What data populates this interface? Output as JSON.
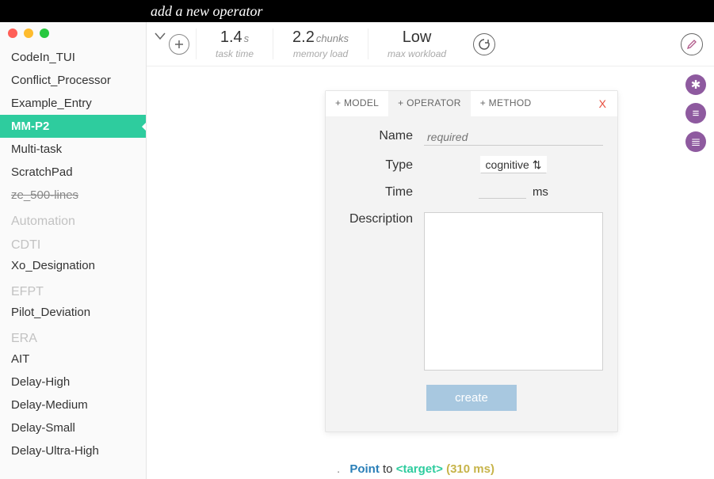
{
  "annotation": "add a new operator",
  "sidebar": {
    "items": [
      {
        "label": "CodeIn_TUI",
        "active": false
      },
      {
        "label": "Conflict_Processor",
        "active": false
      },
      {
        "label": "Example_Entry",
        "active": false
      },
      {
        "label": "MM-P2",
        "active": true
      },
      {
        "label": "Multi-task",
        "active": false
      },
      {
        "label": "ScratchPad",
        "active": false
      },
      {
        "label": "ze_500-lines",
        "strike": true
      }
    ],
    "groups": [
      {
        "heading": "Automation",
        "items": []
      },
      {
        "heading": "CDTI",
        "items": [
          {
            "label": "Xo_Designation"
          }
        ]
      },
      {
        "heading": "EFPT",
        "items": [
          {
            "label": "Pilot_Deviation"
          }
        ]
      },
      {
        "heading": "ERA",
        "items": [
          {
            "label": "AIT"
          },
          {
            "label": "Delay-High"
          },
          {
            "label": "Delay-Medium"
          },
          {
            "label": "Delay-Small"
          },
          {
            "label": "Delay-Ultra-High"
          }
        ]
      }
    ]
  },
  "metrics": {
    "task_time": {
      "value": "1.4",
      "unit": "s",
      "label": "task time"
    },
    "memory_load": {
      "value": "2.2",
      "unit": "chunks",
      "label": "memory load"
    },
    "max_workload": {
      "value": "Low",
      "unit": "",
      "label": "max workload"
    }
  },
  "dialog": {
    "tabs": {
      "model": "+ MODEL",
      "operator": "+ OPERATOR",
      "method": "+ METHOD"
    },
    "close": "X",
    "fields": {
      "name_label": "Name",
      "name_placeholder": "required",
      "type_label": "Type",
      "type_value": "cognitive",
      "time_label": "Time",
      "time_unit": "ms",
      "description_label": "Description"
    },
    "create_button": "create"
  },
  "snippet": {
    "dot": ".",
    "action": "Point",
    "to": "to",
    "target": "<target>",
    "duration": "(310 ms)"
  }
}
